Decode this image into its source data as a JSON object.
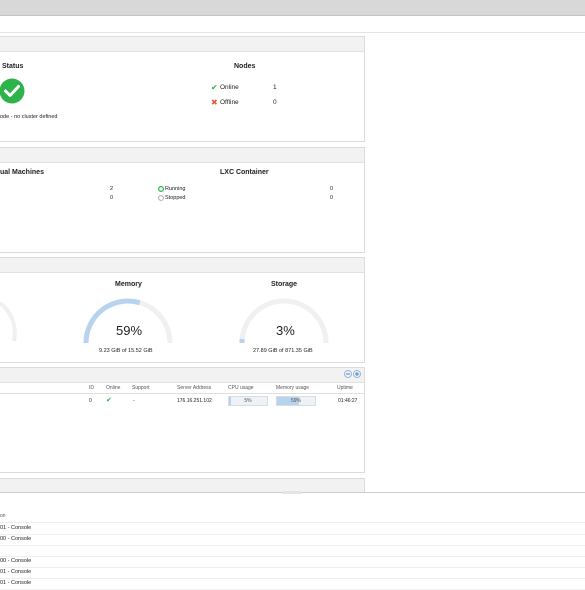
{
  "status_panel": {
    "heading": "Status",
    "cluster_text": "ode - no cluster defined",
    "nodes_heading": "Nodes",
    "online_label": "Online",
    "online_count": "1",
    "offline_label": "Offline",
    "offline_count": "0"
  },
  "guests_panel": {
    "vm_heading": "ual Machines",
    "lxc_heading": "LXC Container",
    "vm_running_count": "2",
    "vm_stopped_count": "0",
    "running_label": "Running",
    "stopped_label": "Stopped",
    "lxc_running_count": "0",
    "lxc_stopped_count": "0"
  },
  "resources_panel": {
    "memory_heading": "Memory",
    "memory_percent": "59%",
    "memory_detail": "9.23 GiB of 15.52 GiB",
    "memory_fraction": 0.59,
    "storage_heading": "Storage",
    "storage_percent": "3%",
    "storage_detail": "27.89 GiB of 871.35 GiB",
    "storage_fraction": 0.03
  },
  "nodes_grid": {
    "columns": {
      "id": "ID",
      "online": "Online",
      "support": "Support",
      "server_address": "Server Address",
      "cpu_usage": "CPU usage",
      "memory_usage": "Memory usage",
      "uptime": "Uptime"
    },
    "row": {
      "id": "0",
      "support": "-",
      "server_address": "176.16.251.102",
      "cpu_usage": "5%",
      "cpu_fraction": 0.05,
      "memory_usage": "59%",
      "memory_fraction": 0.59,
      "uptime": "01:46:27"
    }
  },
  "task_log": {
    "header": "on",
    "rows": [
      "01 - Console",
      "00 - Console",
      "",
      "00 - Console",
      "01 - Console",
      "01 - Console"
    ]
  },
  "colors": {
    "accent": "#2db34a",
    "gauge_fill": "#b7d3ee",
    "gauge_track": "#eef0f2",
    "error": "#e05a3a"
  }
}
